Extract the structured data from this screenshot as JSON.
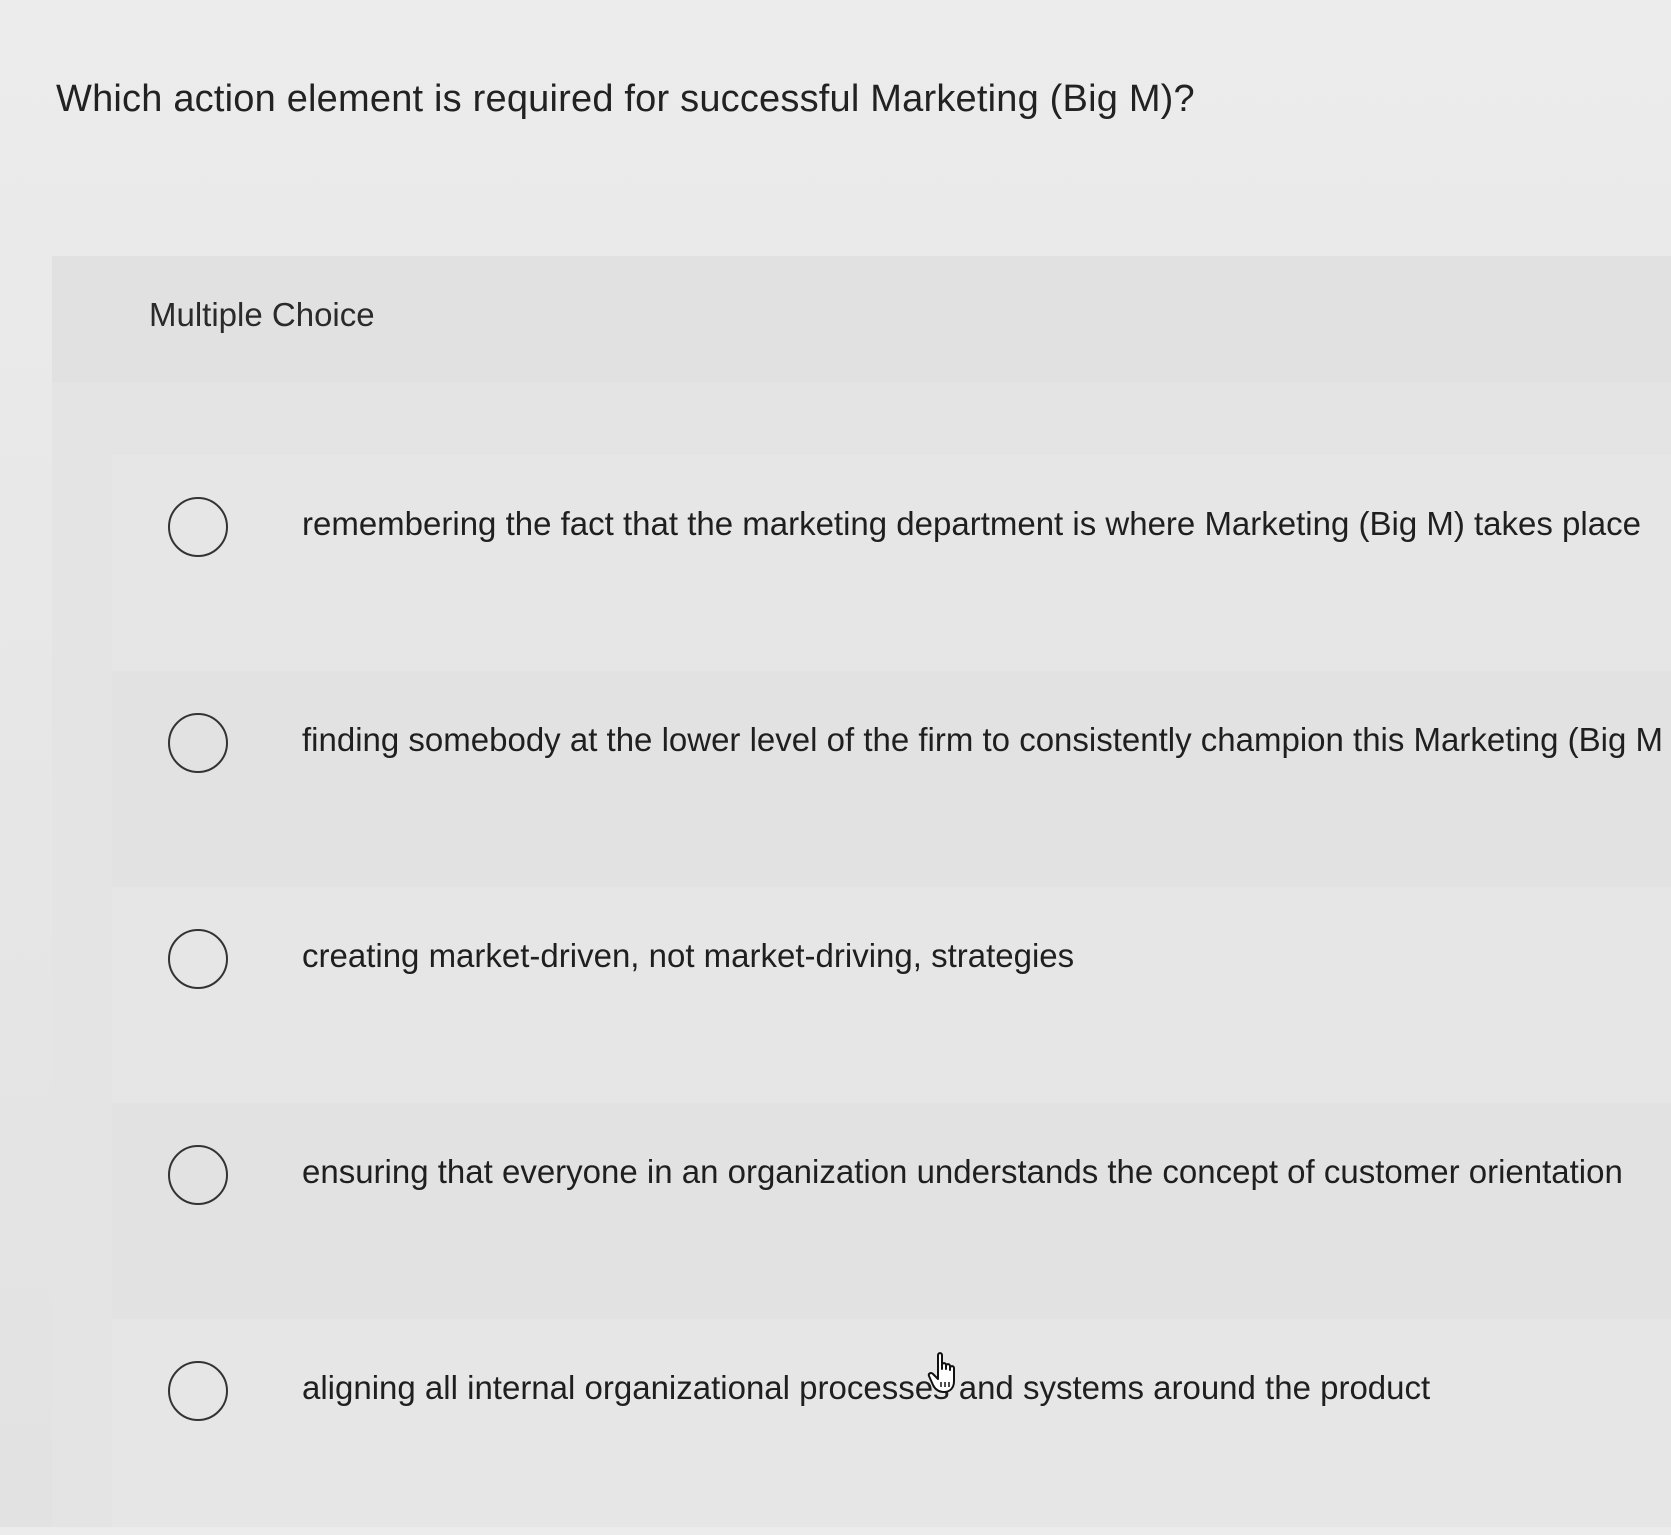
{
  "question": {
    "text": "Which action element is required for successful Marketing (Big M)?"
  },
  "multiple_choice": {
    "label": "Multiple Choice",
    "options": [
      {
        "label": "remembering the fact that the marketing department is where Marketing (Big M) takes place"
      },
      {
        "label": "finding somebody at the lower level of the firm to consistently champion this Marketing (Big M"
      },
      {
        "label": "creating market-driven, not market-driving, strategies"
      },
      {
        "label": "ensuring that everyone in an organization understands the concept of customer orientation"
      },
      {
        "label": "aligning all internal organizational processes and systems around the product"
      }
    ]
  },
  "cursor": {
    "icon": "hand-pointer-icon"
  }
}
